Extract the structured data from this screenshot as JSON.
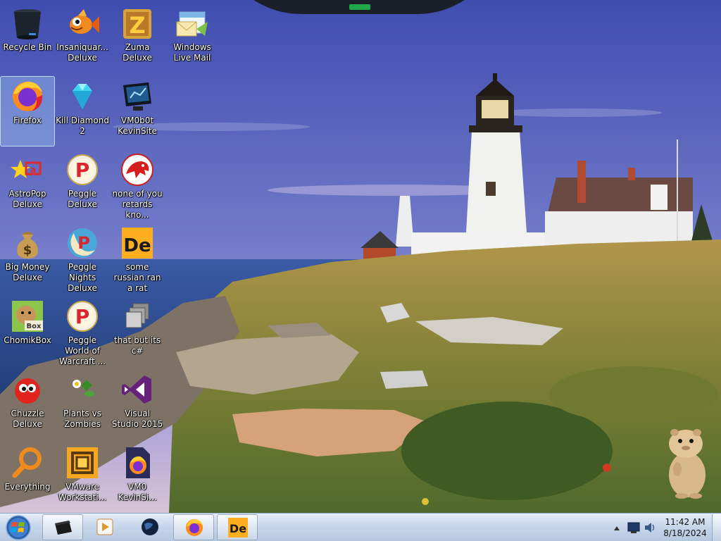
{
  "desktop": {
    "icons": [
      {
        "label": "Recycle Bin",
        "icon": "recycle-bin-icon"
      },
      {
        "label": "Insaniquar... Deluxe",
        "icon": "goldfish-icon"
      },
      {
        "label": "Zuma Deluxe",
        "icon": "zuma-icon"
      },
      {
        "label": "Windows Live Mail",
        "icon": "mail-icon"
      },
      {
        "label": "Firefox",
        "icon": "firefox-icon"
      },
      {
        "label": "Kill Diamond 2",
        "icon": "diamond-icon"
      },
      {
        "label": "VM0b0t KevinSite",
        "icon": "monitor-icon"
      },
      {
        "label": "AstroPop Deluxe",
        "icon": "astropop-icon"
      },
      {
        "label": "Peggle Deluxe",
        "icon": "peggle-icon"
      },
      {
        "label": "none of you retards kno...",
        "icon": "red-dino-icon"
      },
      {
        "label": "Big Money Deluxe",
        "icon": "money-bag-icon"
      },
      {
        "label": "Peggle Nights Deluxe",
        "icon": "peggle-nights-icon"
      },
      {
        "label": "some russian ran a rat",
        "icon": "de-icon"
      },
      {
        "label": "ChomikBox",
        "icon": "chomikbox-icon"
      },
      {
        "label": "Peggle World of Warcraft ...",
        "icon": "peggle-icon"
      },
      {
        "label": "that but its c#",
        "icon": "stacked-windows-icon"
      },
      {
        "label": "Chuzzle Deluxe",
        "icon": "chuzzle-icon"
      },
      {
        "label": "Plants vs Zombies",
        "icon": "plants-icon"
      },
      {
        "label": "Visual Studio 2015",
        "icon": "visual-studio-icon"
      },
      {
        "label": "Everything",
        "icon": "magnifier-icon"
      },
      {
        "label": "VMware Workstati...",
        "icon": "vmware-icon"
      },
      {
        "label": "VM0 KevinSi...",
        "icon": "firefox-file-icon"
      }
    ],
    "selected": "Firefox"
  },
  "taskbar": {
    "buttons": [
      {
        "name": "taskbar-terminal-button",
        "icon": "terminal-icon",
        "open": true
      },
      {
        "name": "taskbar-media-player-button",
        "icon": "media-player-icon",
        "open": false
      },
      {
        "name": "taskbar-globe-button",
        "icon": "globe-icon",
        "open": false
      },
      {
        "name": "taskbar-firefox-button",
        "icon": "firefox-icon",
        "open": true
      },
      {
        "name": "taskbar-de-button",
        "icon": "de-icon",
        "open": true
      }
    ],
    "tray": {
      "time": "11:42 AM",
      "date": "8/18/2024"
    }
  },
  "colors": {
    "sky_top": "#4a56b0",
    "sky_horizon": "#b3a4d6",
    "grass": "#8a8a3a",
    "taskbar": "#c7d6ea"
  }
}
